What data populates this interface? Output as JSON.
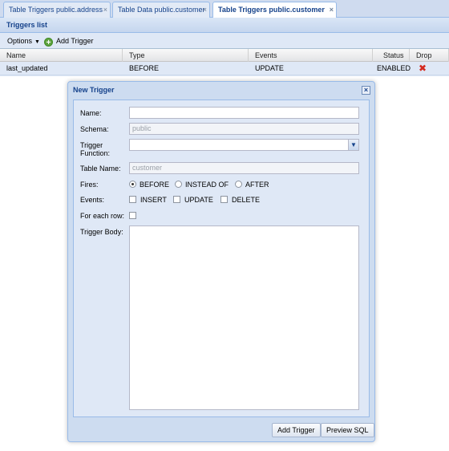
{
  "tabs": [
    {
      "label": "Table Triggers public.address",
      "active": false
    },
    {
      "label": "Table Data public.customer",
      "active": false
    },
    {
      "label": "Table Triggers public.customer",
      "active": true
    }
  ],
  "tab_close_glyph": "×",
  "panel": {
    "title": "Triggers list"
  },
  "toolbar": {
    "options_label": "Options",
    "add_trigger_label": "Add Trigger"
  },
  "grid": {
    "columns": [
      "Name",
      "Type",
      "Events",
      "Status",
      "Drop"
    ],
    "rows": [
      {
        "name": "last_updated",
        "type": "BEFORE",
        "events": "UPDATE",
        "status": "ENABLED",
        "drop_icon": "delete-x-icon"
      }
    ]
  },
  "dialog": {
    "title": "New Trigger",
    "labels": {
      "name": "Name:",
      "schema": "Schema:",
      "trigger_function_1": "Trigger",
      "trigger_function_2": "Function:",
      "table_name": "Table Name:",
      "fires": "Fires:",
      "events": "Events:",
      "for_each_row": "For each row:",
      "trigger_body": "Trigger Body:"
    },
    "values": {
      "name": "",
      "schema": "public",
      "trigger_function": "",
      "table_name": "customer"
    },
    "fires_options": [
      "BEFORE",
      "INSTEAD OF",
      "AFTER"
    ],
    "fires_selected": "BEFORE",
    "event_options": [
      "INSERT",
      "UPDATE",
      "DELETE"
    ],
    "buttons": {
      "add": "Add Trigger",
      "preview": "Preview SQL"
    }
  },
  "colors": {
    "accent": "#15428b",
    "panel_bg": "#dfe8f6",
    "drop_red": "#d42a1f"
  }
}
